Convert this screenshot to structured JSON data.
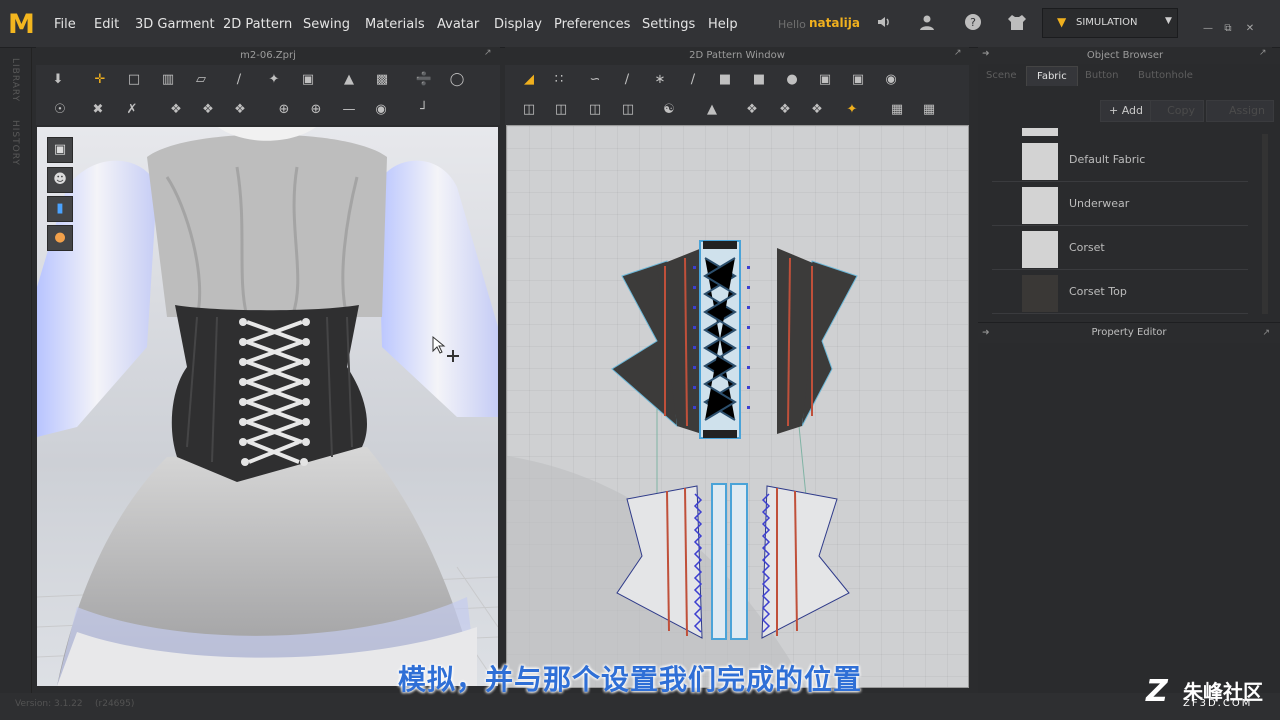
{
  "app": {
    "logo": "M",
    "menu": [
      "File",
      "Edit",
      "3D Garment",
      "2D Pattern",
      "Sewing",
      "Materials",
      "Avatar",
      "Display",
      "Preferences",
      "Settings",
      "Help"
    ],
    "hello": "Hello",
    "username": "natalija",
    "simulation_label": "SIMULATION"
  },
  "side_tabs": [
    "LIBRARY",
    "HISTORY"
  ],
  "panels": {
    "viewport3d_title": "m2-06.Zprj",
    "viewport2d_title": "2D Pattern Window",
    "object_browser_title": "Object Browser",
    "property_editor_title": "Property Editor"
  },
  "object_browser": {
    "tabs": [
      "Scene",
      "Fabric",
      "Button",
      "Buttonhole"
    ],
    "active_tab": "Fabric",
    "actions": [
      "+ Add",
      "Copy",
      "Assign"
    ],
    "fabrics": [
      {
        "name": "Default Fabric",
        "color": "#d3d3d3"
      },
      {
        "name": "Underwear",
        "color": "#d3d3d3"
      },
      {
        "name": "Corset",
        "color": "#d3d3d3"
      },
      {
        "name": "Corset Top",
        "color": "#3a3836"
      }
    ]
  },
  "status": {
    "version": "Version: 3.1.22",
    "build": "(r24695)"
  },
  "overlay": {
    "subtitle": "模拟，并与那个设置我们完成的位置",
    "watermark_text": "朱峰社区",
    "watermark_url": "ZF3D.COM"
  },
  "colors": {
    "accent": "#f0b01e",
    "panel_bg": "#2a2b2d",
    "pattern_dark": "#3c3b3a",
    "pattern_outline": "#4aa3d8",
    "pattern_seam": "#c0503a"
  },
  "icons": {
    "viewport_buttons": [
      "garment-icon",
      "avatar-icon",
      "texture-icon",
      "skin-icon"
    ]
  }
}
